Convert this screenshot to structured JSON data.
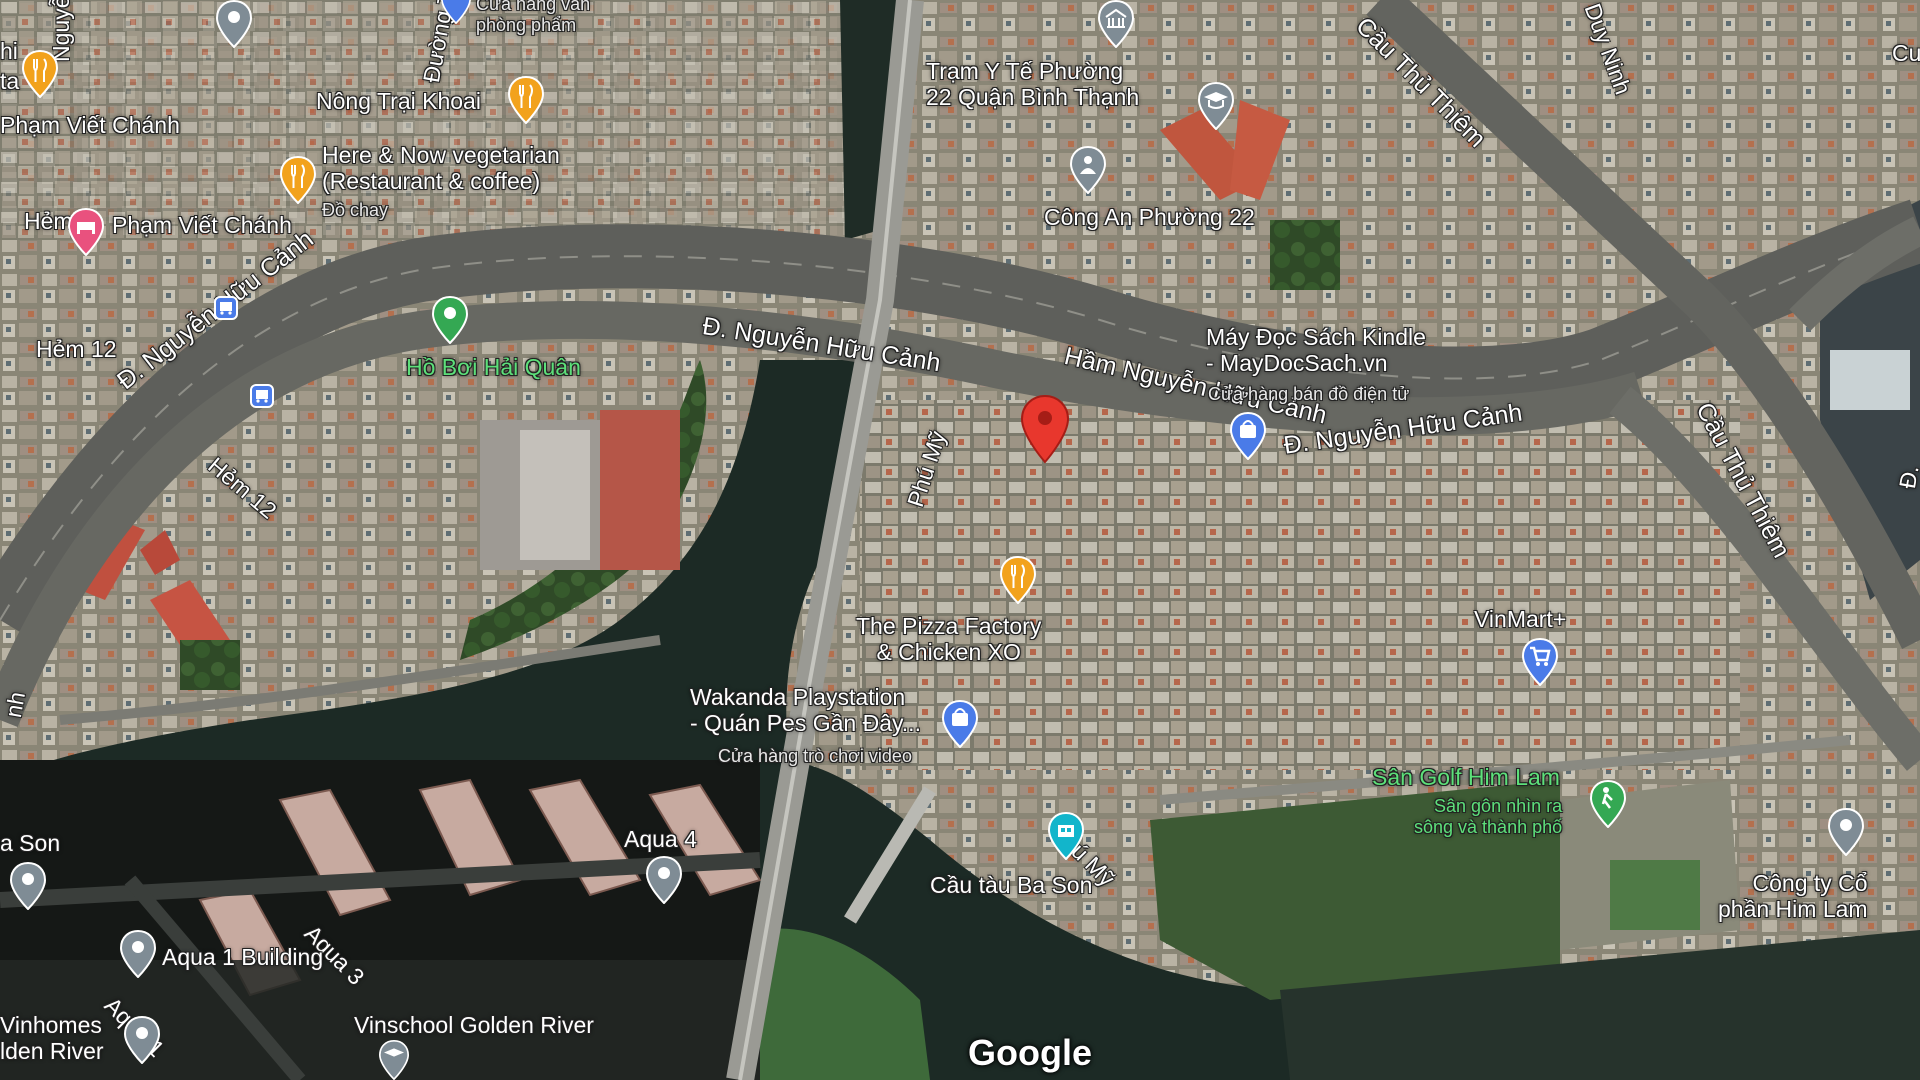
{
  "map": {
    "roads": {
      "main_left": "Đ. Nguyễn Hữu Cảnh",
      "main_center": "Đ. Nguyễn Hữu Cảnh",
      "main_right": "Đ. Nguyễn Hữu Cảnh",
      "tunnel": "Hầm Nguyễn Hữu Cảnh",
      "bridge_top": "Cầu Thủ Thiêm",
      "bridge_right": "Cầu Thủ Thiêm",
      "phu_my_1": "Phú Mỹ",
      "phu_my_2": "Phú Mỹ",
      "hem12_a": "Hẻm 12",
      "hem12_b": "Hẻm 12",
      "hem_top": "Hẻm",
      "pham_viet_chanh_1": "Phạm Viết Chánh",
      "pham_viet_chanh_2": "Phạm Viết Chánh",
      "duong": "Đường T",
      "nguyen_top": "Nguyễn",
      "duy_ninh": "Duy Ninh",
      "aqua3": "Aqua 3",
      "aqua1": "Aqua 1",
      "edge_d": "Đ.",
      "edge_cu": "Cu",
      "edge_thi": "hi",
      "edge_ta": "ta",
      "edge_nh": "nh"
    },
    "places": {
      "nong_trai": "Nông Trại Khoai",
      "here_now_1": "Here & Now vegetarian",
      "here_now_2": "(Restaurant & coffee)",
      "here_now_sub": "Đồ chay",
      "tram_yte_1": "Trạm Y Tế Phường",
      "tram_yte_2": "22 Quận Bình Thạnh",
      "cong_an": "Công An Phường 22",
      "kindle_1": "Máy Đọc Sách Kindle",
      "kindle_2": "- MayDocSach.vn",
      "kindle_sub": "Cửa hàng bán đồ điện tử",
      "ho_boi": "Hồ Bơi Hải Quân",
      "pizza_1": "The Pizza Factory",
      "pizza_2": "& Chicken XO",
      "wakanda_1": "Wakanda Playstation",
      "wakanda_2": "- Quán Pes Gần Đây...",
      "wakanda_sub": "Cửa hàng trò chơi video",
      "vinmart": "VinMart+",
      "golf_1": "Sân Golf Him Lam",
      "golf_sub_1": "Sân gôn nhìn ra",
      "golf_sub_2": "sông và thành phố",
      "cau_tau": "Cầu tàu Ba Son",
      "aqua4": "Aqua 4",
      "aqua1_building": "Aqua 1 Building",
      "vinschool": "Vinschool Golden River",
      "vinhomes_1": "Vinhomes",
      "vinhomes_2": "lden River",
      "ba_son": "a Son",
      "him_lam_1": "Công ty Cổ",
      "him_lam_2": "phần Him Lam",
      "top_store_1": "Cửa hàng văn",
      "top_store_2": "phòng phẩm"
    },
    "logo": "Google"
  }
}
